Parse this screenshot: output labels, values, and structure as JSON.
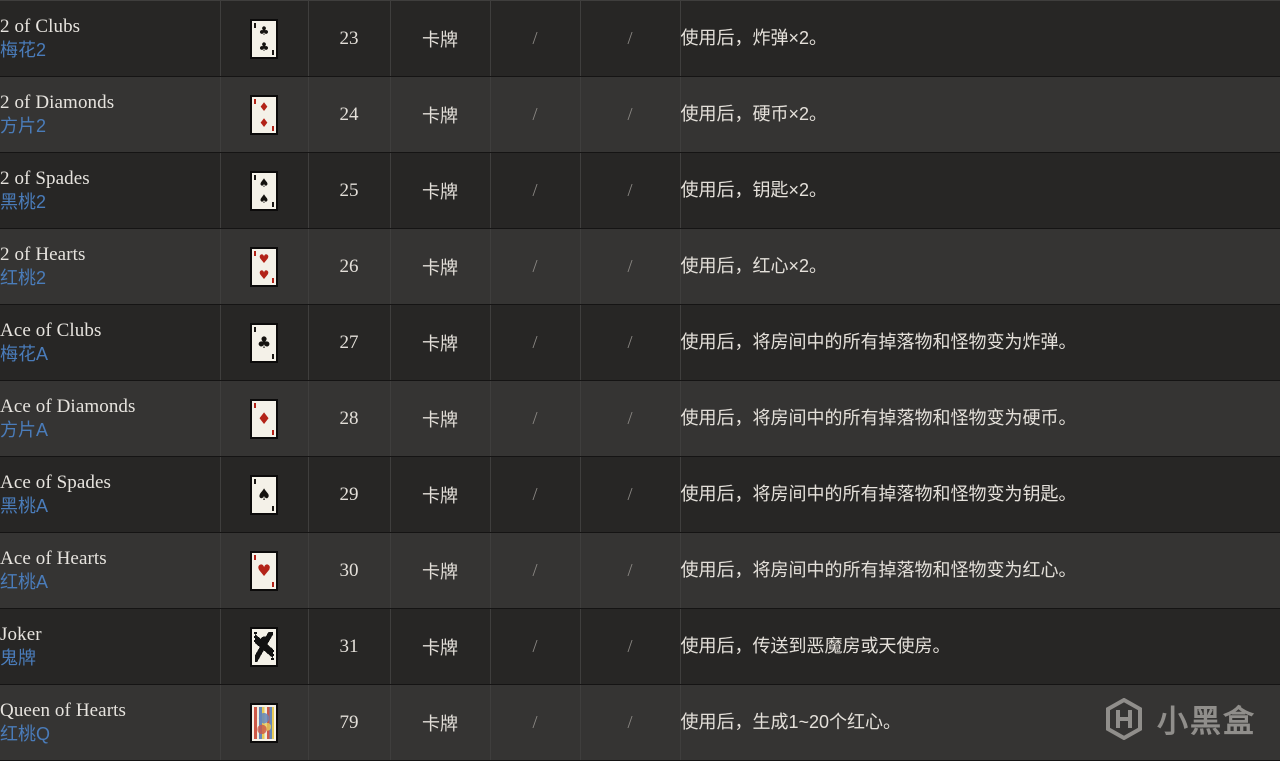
{
  "table": {
    "columns": [
      "name",
      "image",
      "id",
      "type",
      "quality",
      "pool",
      "description"
    ],
    "rows": [
      {
        "name_en": "2 of Clubs",
        "name_zh": "梅花2",
        "card": "two-of-clubs",
        "id": "23",
        "type": "卡牌",
        "quality": "/",
        "pool": "/",
        "description": "使用后，炸弹×2。"
      },
      {
        "name_en": "2 of Diamonds",
        "name_zh": "方片2",
        "card": "two-of-diamonds",
        "id": "24",
        "type": "卡牌",
        "quality": "/",
        "pool": "/",
        "description": "使用后，硬币×2。"
      },
      {
        "name_en": "2 of Spades",
        "name_zh": "黑桃2",
        "card": "two-of-spades",
        "id": "25",
        "type": "卡牌",
        "quality": "/",
        "pool": "/",
        "description": "使用后，钥匙×2。"
      },
      {
        "name_en": "2 of Hearts",
        "name_zh": "红桃2",
        "card": "two-of-hearts",
        "id": "26",
        "type": "卡牌",
        "quality": "/",
        "pool": "/",
        "description": "使用后，红心×2。"
      },
      {
        "name_en": "Ace of Clubs",
        "name_zh": "梅花A",
        "card": "ace-of-clubs",
        "id": "27",
        "type": "卡牌",
        "quality": "/",
        "pool": "/",
        "description": "使用后，将房间中的所有掉落物和怪物变为炸弹。"
      },
      {
        "name_en": "Ace of Diamonds",
        "name_zh": "方片A",
        "card": "ace-of-diamonds",
        "id": "28",
        "type": "卡牌",
        "quality": "/",
        "pool": "/",
        "description": "使用后，将房间中的所有掉落物和怪物变为硬币。"
      },
      {
        "name_en": "Ace of Spades",
        "name_zh": "黑桃A",
        "card": "ace-of-spades",
        "id": "29",
        "type": "卡牌",
        "quality": "/",
        "pool": "/",
        "description": "使用后，将房间中的所有掉落物和怪物变为钥匙。"
      },
      {
        "name_en": "Ace of Hearts",
        "name_zh": "红桃A",
        "card": "ace-of-hearts",
        "id": "30",
        "type": "卡牌",
        "quality": "/",
        "pool": "/",
        "description": "使用后，将房间中的所有掉落物和怪物变为红心。"
      },
      {
        "name_en": "Joker",
        "name_zh": "鬼牌",
        "card": "joker",
        "id": "31",
        "type": "卡牌",
        "quality": "/",
        "pool": "/",
        "description": "使用后，传送到恶魔房或天使房。"
      },
      {
        "name_en": "Queen of Hearts",
        "name_zh": "红桃Q",
        "card": "queen-of-hearts",
        "id": "79",
        "type": "卡牌",
        "quality": "/",
        "pool": "/",
        "description": "使用后，生成1~20个红心。"
      }
    ]
  },
  "watermark": {
    "text": "小黑盒",
    "logo": "xiaoheihe-logo-icon"
  },
  "colors": {
    "row_odd": "#272625",
    "row_even": "#353433",
    "link_blue": "#4a7cba",
    "text_primary": "#e4e0da",
    "text_muted": "#8d8a86",
    "suit_red": "#b32318",
    "suit_black": "#14120f"
  }
}
